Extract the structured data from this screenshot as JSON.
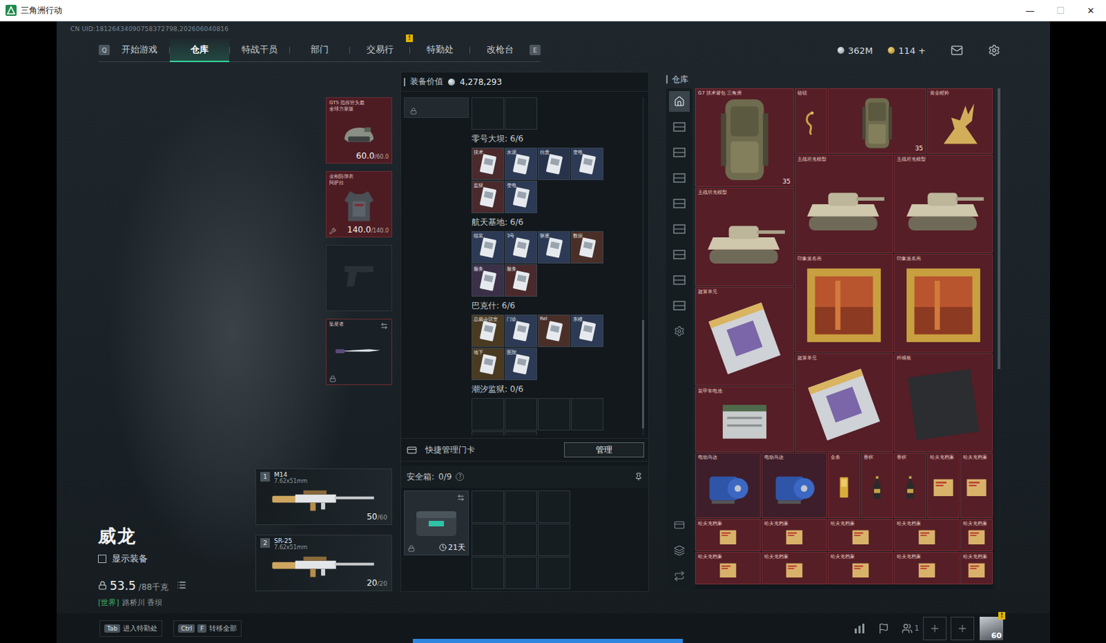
{
  "window": {
    "title": "三角洲行动",
    "controls": [
      "—",
      "☐",
      "✕"
    ]
  },
  "uid": "CN UID:18126434090758372798,202606040816",
  "nav": {
    "left_key": "Q",
    "right_key": "E",
    "tabs": [
      {
        "label": "开始游戏",
        "selected": false,
        "badge": ""
      },
      {
        "label": "仓库",
        "selected": true,
        "badge": ""
      },
      {
        "label": "特战干员",
        "selected": false,
        "badge": ""
      },
      {
        "label": "部门",
        "selected": false,
        "badge": ""
      },
      {
        "label": "交易行",
        "selected": false,
        "badge": ""
      },
      {
        "label": "特勤处",
        "selected": false,
        "badge": "!"
      },
      {
        "label": "改枪台",
        "selected": false,
        "badge": ""
      }
    ],
    "currency": [
      {
        "kind": "coin",
        "value": "362M"
      },
      {
        "kind": "ticket",
        "value": "114 +"
      }
    ]
  },
  "character": {
    "name": "威龙",
    "show_equipment": {
      "label": "显示装备",
      "checked": false
    },
    "weight": "53.5",
    "weight_max": "/88千克",
    "location_tag": "[世界]",
    "location": "路桥川 香坝"
  },
  "gear": [
    {
      "kind": "helmet",
      "name": "GT5 指挥官头盔",
      "sub": "全球力量版",
      "value": "60.0",
      "max": "/60.0",
      "empty": false,
      "locked": false,
      "color": "#4d1c23"
    },
    {
      "kind": "armor",
      "name": "金刚防弹衣",
      "sub": "阿萨拉",
      "value": "140.0",
      "max": "/140.0",
      "empty": false,
      "locked": false,
      "color": "#4d1c23"
    },
    {
      "kind": "pistol",
      "name": "",
      "sub": "",
      "value": "",
      "max": "",
      "empty": true,
      "locked": false,
      "color": "#1a2126"
    },
    {
      "kind": "melee",
      "name": "坠星者",
      "sub": "",
      "value": "",
      "max": "",
      "empty": false,
      "locked": true,
      "color": "#1a2126"
    }
  ],
  "weapons": [
    {
      "slot": "1",
      "name": "M14",
      "caliber": "7.62x51mm",
      "ammo": "50",
      "ammo_max": "/60"
    },
    {
      "slot": "2",
      "name": "SR-25",
      "caliber": "7.62x51mm",
      "ammo": "20",
      "ammo_max": "/20"
    }
  ],
  "loadout": {
    "value_label": "装备价值",
    "value": "4,278,293",
    "top_empty": 2,
    "sections": [
      {
        "label": "零号大坝: 6/6",
        "empty": 0,
        "cards": [
          {
            "label": "技术",
            "color": "#4a2a2c"
          },
          {
            "label": "水泥",
            "color": "#2c3a55"
          },
          {
            "label": "仿贵",
            "color": "#27334b"
          },
          {
            "label": "变电",
            "color": "#2c3a55"
          },
          {
            "label": "监狱",
            "color": "#4a2a2c"
          },
          {
            "label": "变电",
            "color": "#2c3a55"
          }
        ]
      },
      {
        "label": "航天基地: 6/6",
        "empty": 0,
        "cards": [
          {
            "label": "组装",
            "color": "#2c3a55"
          },
          {
            "label": "3号",
            "color": "#2c3a55"
          },
          {
            "label": "驱逐",
            "color": "#2c3a55"
          },
          {
            "label": "数据",
            "color": "#4a2f28"
          },
          {
            "label": "服务",
            "color": "#3a3048"
          },
          {
            "label": "服务",
            "color": "#4a2a2c"
          }
        ]
      },
      {
        "label": "巴克什: 6/6",
        "empty": 0,
        "cards": [
          {
            "label": "总裁会议室",
            "color": "#4a3a22"
          },
          {
            "label": "门诊",
            "color": "#2c3a55"
          },
          {
            "label": "Rel",
            "color": "#4a2f28"
          },
          {
            "label": "东楼",
            "color": "#2c3a55"
          },
          {
            "label": "地下",
            "color": "#4a3a22"
          },
          {
            "label": "医院",
            "color": "#2c3a55"
          }
        ]
      },
      {
        "label": "潮汐监狱: 0/6",
        "empty": 6,
        "cards": []
      }
    ],
    "manage_label": "快捷管理门卡",
    "manage_button": "管理",
    "safe_label": "安全箱:",
    "safe_count": "0/9",
    "safe_help": "?",
    "safe_timer": "21天"
  },
  "warehouse": {
    "title": "仓库",
    "side_tabs": [
      {
        "kind": "home",
        "selected": true
      },
      {
        "kind": "shelf",
        "selected": false
      },
      {
        "kind": "shelf",
        "selected": false
      },
      {
        "kind": "shelf",
        "selected": false
      },
      {
        "kind": "shelf",
        "selected": false
      },
      {
        "kind": "shelf",
        "selected": false
      },
      {
        "kind": "shelf",
        "selected": false
      },
      {
        "kind": "shelf",
        "selected": false
      },
      {
        "kind": "shelf",
        "selected": false
      },
      {
        "kind": "settings",
        "selected": false
      }
    ],
    "bottom_tabs": [
      {
        "kind": "card"
      },
      {
        "kind": "layers"
      },
      {
        "kind": "transfer"
      }
    ],
    "items": [
      {
        "kind": "backpack",
        "label": "G7 技术背包 三角洲",
        "count": "35",
        "color": "#561e26"
      },
      {
        "kind": "ornament",
        "label": "链钮",
        "count": "",
        "color": "#561e26"
      },
      {
        "kind": "backpack",
        "label": "",
        "count": "35",
        "color": "#561e26"
      },
      {
        "kind": "deer",
        "label": "黄金瞪羚",
        "count": "",
        "color": "#561e26"
      },
      {
        "kind": "tank",
        "label": "主战坦克模型",
        "count": "",
        "color": "#561e26"
      },
      {
        "kind": "tank",
        "label": "主战坦克模型",
        "count": "",
        "color": "#561e26"
      },
      {
        "kind": "tank",
        "label": "主战坦克模型",
        "count": "",
        "color": "#561e26"
      },
      {
        "kind": "painting",
        "label": "印象派名画",
        "count": "",
        "color": "#561e26"
      },
      {
        "kind": "painting",
        "label": "印象派名画",
        "count": "",
        "color": "#561e26"
      },
      {
        "kind": "chip",
        "label": "超算单元",
        "count": "",
        "color": "#561e26"
      },
      {
        "kind": "chip",
        "label": "超算单元",
        "count": "",
        "color": "#561e26"
      },
      {
        "kind": "board",
        "label": "纤维板",
        "count": "",
        "color": "#561e26"
      },
      {
        "kind": "battery",
        "label": "装甲车电池",
        "count": "",
        "color": "#561e26"
      },
      {
        "kind": "motor",
        "label": "电动马达",
        "count": "",
        "color": "#3e1e2a"
      },
      {
        "kind": "motor",
        "label": "电动马达",
        "count": "",
        "color": "#3e1e2a"
      },
      {
        "kind": "gold",
        "label": "金条",
        "count": "",
        "color": "#561e26"
      },
      {
        "kind": "bottle",
        "label": "香槟",
        "count": "",
        "color": "#561e26"
      },
      {
        "kind": "bottle",
        "label": "香槟",
        "count": "",
        "color": "#561e26"
      },
      {
        "kind": "file",
        "label": "哈夫克档案",
        "count": "",
        "color": "#561e26"
      },
      {
        "kind": "file",
        "label": "哈夫克档案",
        "count": "",
        "color": "#561e26"
      },
      {
        "kind": "file",
        "label": "哈夫克档案",
        "count": "",
        "color": "#561e26"
      },
      {
        "kind": "file",
        "label": "哈夫克档案",
        "count": "",
        "color": "#561e26"
      },
      {
        "kind": "file",
        "label": "哈夫克档案",
        "count": "",
        "color": "#561e26"
      },
      {
        "kind": "file",
        "label": "哈夫克档案",
        "count": "",
        "color": "#561e26"
      },
      {
        "kind": "file",
        "label": "哈夫克档案",
        "count": "",
        "color": "#561e26"
      },
      {
        "kind": "file",
        "label": "哈夫克档案",
        "count": "",
        "color": "#561e26"
      },
      {
        "kind": "file",
        "label": "哈夫克档案",
        "count": "",
        "color": "#561e26"
      },
      {
        "kind": "file",
        "label": "哈夫克档案",
        "count": "",
        "color": "#561e26"
      },
      {
        "kind": "file",
        "label": "哈夫克档案",
        "count": "",
        "color": "#561e26"
      },
      {
        "kind": "file",
        "label": "哈夫克档案",
        "count": "",
        "color": "#561e26"
      }
    ]
  },
  "bottom": {
    "hints": [
      {
        "keys": [
          "Tab"
        ],
        "label": "进入特勤处"
      },
      {
        "keys": [
          "Ctrl",
          "F"
        ],
        "label": "转移全部"
      }
    ],
    "friends": "1",
    "level": "60",
    "badge": "!"
  }
}
